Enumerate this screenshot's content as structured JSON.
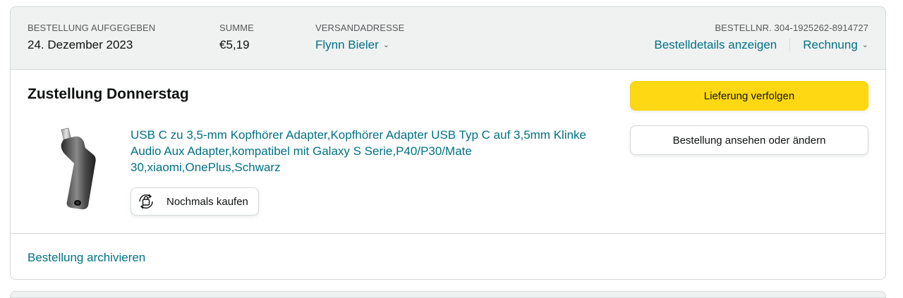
{
  "header": {
    "order_placed_label": "BESTELLUNG AUFGEGEBEN",
    "order_placed_value": "24. Dezember 2023",
    "total_label": "SUMME",
    "total_value": "€5,19",
    "ship_to_label": "VERSANDADRESSE",
    "ship_to_value": "Flynn Bieler",
    "order_number_label": "BESTELLNR. 304-1925262-8914727",
    "details_link": "Bestelldetails anzeigen",
    "invoice_link": "Rechnung"
  },
  "delivery": {
    "title": "Zustellung Donnerstag"
  },
  "product": {
    "title": "USB C zu 3,5-mm Kopfhörer Adapter,Kopfhörer Adapter USB Typ C auf 3,5mm Klinke Audio Aux Adapter,kompatibel mit Galaxy S Serie,P40/P30/Mate 30,xiaomi,OnePlus,Schwarz",
    "buy_again_label": "Nochmals kaufen",
    "buy_again_icon": "buy-again-icon"
  },
  "actions": {
    "track_label": "Lieferung verfolgen",
    "view_edit_label": "Bestellung ansehen oder ändern"
  },
  "footer": {
    "archive_link": "Bestellung archivieren"
  },
  "colors": {
    "link": "#007185",
    "primary_button": "#ffd814",
    "header_bg": "#f0f2f2",
    "border": "#d5d9d9"
  }
}
